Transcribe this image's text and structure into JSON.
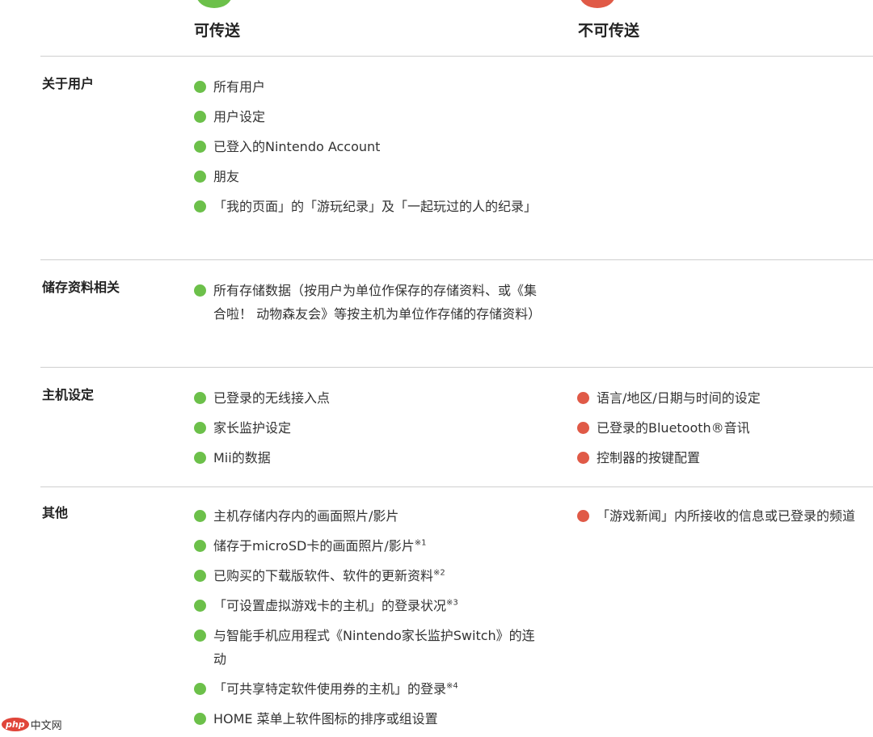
{
  "header": {
    "transferable": "可传送",
    "not_transferable": "不可传送"
  },
  "sections": [
    {
      "label": "关于用户",
      "transferable": [
        "所有用户",
        "用户设定",
        "已登入的Nintendo Account",
        "朋友",
        "「我的页面」的「游玩纪录」及「一起玩过的人的纪录」"
      ],
      "not_transferable": []
    },
    {
      "label": "储存资料相关",
      "transferable": [
        "所有存储数据（按用户为单位作保存的存储资料、或《集合啦！ 动物森友会》等按主机为单位作存储的存储资料）"
      ],
      "not_transferable": []
    },
    {
      "label": "主机设定",
      "transferable": [
        "已登录的无线接入点",
        "家长监护设定",
        "Mii的数据"
      ],
      "not_transferable": [
        "语言/地区/日期与时间的设定",
        "已登录的Bluetooth®音讯",
        "控制器的按键配置"
      ]
    },
    {
      "label": "其他",
      "transferable": [
        {
          "text": "主机存储内存内的画面照片/影片",
          "note": ""
        },
        {
          "text": "储存于microSD卡的画面照片/影片",
          "note": "※1"
        },
        {
          "text": "已购买的下载版软件、软件的更新资料",
          "note": "※2"
        },
        {
          "text": "「可设置虚拟游戏卡的主机」的登录状况",
          "note": "※3"
        },
        {
          "text": "与智能手机应用程式《Nintendo家长监护Switch》的连动",
          "note": ""
        },
        {
          "text": "「可共享特定软件使用券的主机」的登录",
          "note": "※4"
        },
        {
          "text": "HOME 菜单上软件图标的排序或组设置",
          "note": ""
        }
      ],
      "not_transferable": [
        "「游戏新闻」内所接收的信息或已登录的频道"
      ]
    }
  ],
  "watermark": {
    "logo": "php",
    "text": "中文网"
  },
  "colors": {
    "transferable": "#6cc04a",
    "not_transferable": "#e05a47",
    "divider": "#cfcfcf"
  }
}
